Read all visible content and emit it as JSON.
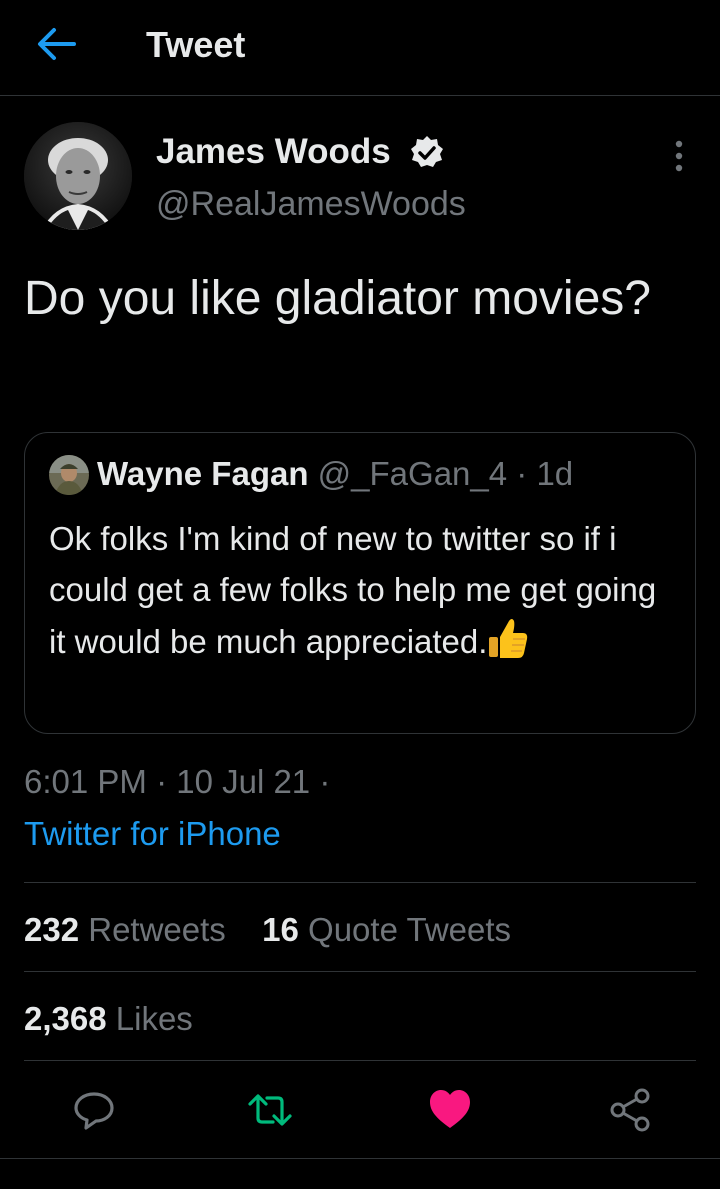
{
  "header": {
    "title": "Tweet",
    "back_icon": "arrow-left-icon"
  },
  "author": {
    "name": "James Woods",
    "handle": "@RealJamesWoods",
    "verified": true
  },
  "tweet": {
    "text": "Do you like gladiator movies?"
  },
  "quote": {
    "name": "Wayne Fagan",
    "handle": "@_FaGan_4",
    "time": "· 1d",
    "text": "Ok folks I'm kind of new to twitter so if i could get a few folks to help me get going it would be much appreciated.",
    "emoji": "thumbs-up-icon"
  },
  "meta": {
    "timestamp": "6:01 PM · 10 Jul 21 ·",
    "source": "Twitter for iPhone"
  },
  "stats": {
    "retweets_count": "232",
    "retweets_label": "Retweets",
    "quotes_count": "16",
    "quotes_label": "Quote Tweets",
    "likes_count": "2,368",
    "likes_label": "Likes"
  },
  "actions": {
    "reply_icon": "reply-icon",
    "retweet_icon": "retweet-icon",
    "like_icon": "heart-icon",
    "share_icon": "share-icon"
  },
  "colors": {
    "background": "#000000",
    "text": "#e7e9ea",
    "secondary": "#71767b",
    "accent": "#1d9bf0",
    "retweet": "#00ba7c",
    "like": "#f91880",
    "divider": "#2f3336"
  }
}
